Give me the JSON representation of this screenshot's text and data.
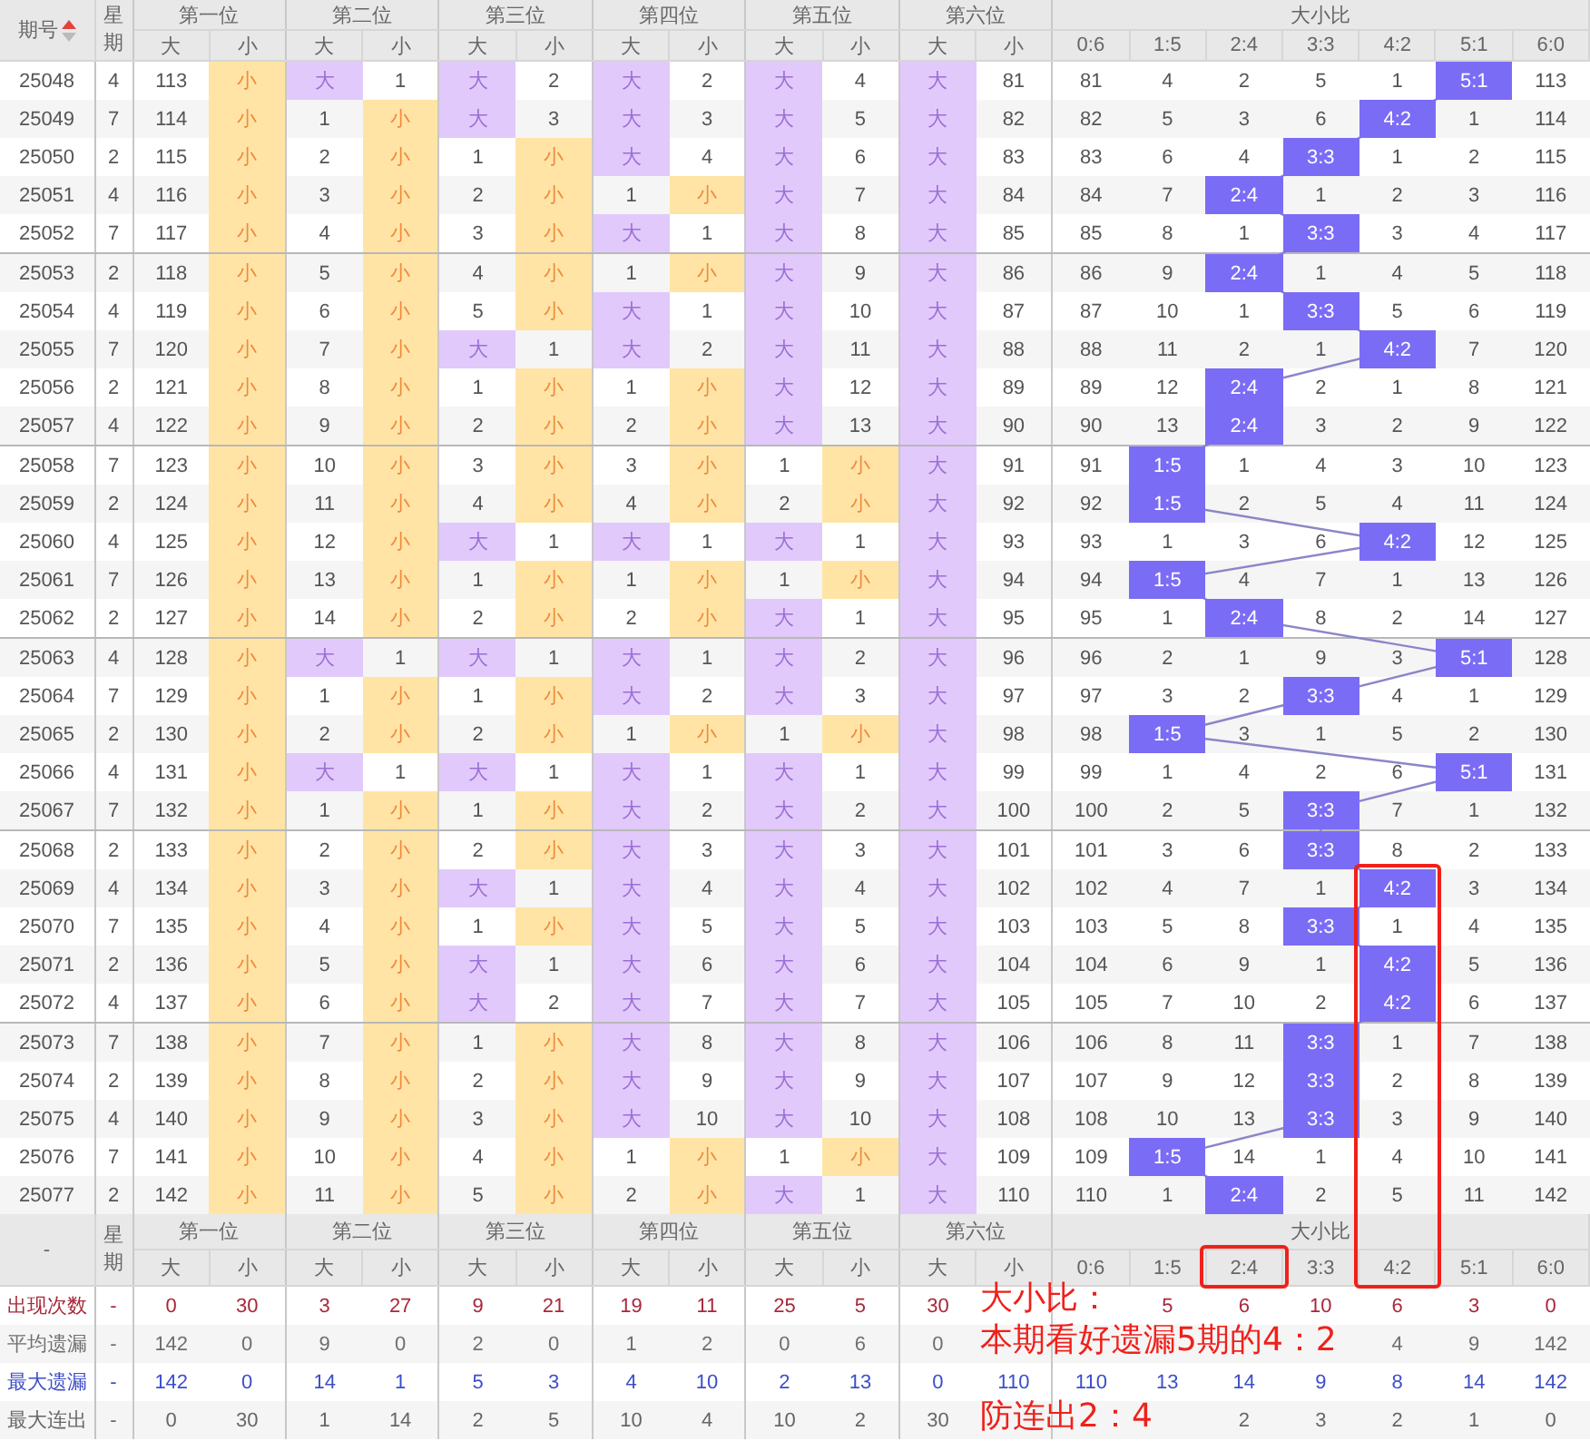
{
  "header": {
    "issue": "期号",
    "weekday": "星期",
    "positions": [
      {
        "name": "第一位",
        "big": "大",
        "small": "小"
      },
      {
        "name": "第二位",
        "big": "大",
        "small": "小"
      },
      {
        "name": "第三位",
        "big": "大",
        "small": "小"
      },
      {
        "name": "第四位",
        "big": "大",
        "small": "小"
      },
      {
        "name": "第五位",
        "big": "大",
        "small": "小"
      },
      {
        "name": "第六位",
        "big": "大",
        "small": "小"
      }
    ],
    "ratio_title": "大小比",
    "ratios": [
      "0:6",
      "1:5",
      "2:4",
      "3:3",
      "4:2",
      "5:1",
      "6:0"
    ]
  },
  "rows": [
    {
      "issue": "25048",
      "weekday": "4",
      "cells": [
        "113",
        "小",
        "大",
        "1",
        "大",
        "2",
        "大",
        "2",
        "大",
        "4",
        "大",
        "81"
      ],
      "big_selected": [
        false,
        true,
        true,
        true,
        true,
        true
      ],
      "ratio": [
        "81",
        "4",
        "2",
        "5",
        "1",
        "5:1",
        "113"
      ],
      "ratio_selected": [
        false,
        false,
        false,
        false,
        false,
        true,
        false
      ]
    },
    {
      "issue": "25049",
      "weekday": "7",
      "cells": [
        "114",
        "小",
        "1",
        "小",
        "大",
        "3",
        "大",
        "3",
        "大",
        "5",
        "大",
        "82"
      ],
      "big_selected": [
        false,
        false,
        true,
        true,
        true,
        true
      ],
      "ratio": [
        "82",
        "5",
        "3",
        "6",
        "4:2",
        "1",
        "114"
      ],
      "ratio_selected": [
        false,
        false,
        false,
        false,
        true,
        false,
        false
      ]
    },
    {
      "issue": "25050",
      "weekday": "2",
      "cells": [
        "115",
        "小",
        "2",
        "小",
        "1",
        "小",
        "大",
        "4",
        "大",
        "6",
        "大",
        "83"
      ],
      "big_selected": [
        false,
        false,
        false,
        true,
        true,
        true
      ],
      "ratio": [
        "83",
        "6",
        "4",
        "3:3",
        "1",
        "2",
        "115"
      ],
      "ratio_selected": [
        false,
        false,
        false,
        true,
        false,
        false,
        false
      ]
    },
    {
      "issue": "25051",
      "weekday": "4",
      "cells": [
        "116",
        "小",
        "3",
        "小",
        "2",
        "小",
        "1",
        "小",
        "大",
        "7",
        "大",
        "84"
      ],
      "big_selected": [
        false,
        false,
        false,
        false,
        true,
        true
      ],
      "ratio": [
        "84",
        "7",
        "2:4",
        "1",
        "2",
        "3",
        "116"
      ],
      "ratio_selected": [
        false,
        false,
        true,
        false,
        false,
        false,
        false
      ]
    },
    {
      "issue": "25052",
      "weekday": "7",
      "cells": [
        "117",
        "小",
        "4",
        "小",
        "3",
        "小",
        "大",
        "1",
        "大",
        "8",
        "大",
        "85"
      ],
      "big_selected": [
        false,
        false,
        false,
        true,
        true,
        true
      ],
      "ratio": [
        "85",
        "8",
        "1",
        "3:3",
        "3",
        "4",
        "117"
      ],
      "ratio_selected": [
        false,
        false,
        false,
        true,
        false,
        false,
        false
      ]
    },
    {
      "issue": "25053",
      "weekday": "2",
      "cells": [
        "118",
        "小",
        "5",
        "小",
        "4",
        "小",
        "1",
        "小",
        "大",
        "9",
        "大",
        "86"
      ],
      "big_selected": [
        false,
        false,
        false,
        false,
        true,
        true
      ],
      "ratio": [
        "86",
        "9",
        "2:4",
        "1",
        "4",
        "5",
        "118"
      ],
      "ratio_selected": [
        false,
        false,
        true,
        false,
        false,
        false,
        false
      ]
    },
    {
      "issue": "25054",
      "weekday": "4",
      "cells": [
        "119",
        "小",
        "6",
        "小",
        "5",
        "小",
        "大",
        "1",
        "大",
        "10",
        "大",
        "87"
      ],
      "big_selected": [
        false,
        false,
        false,
        true,
        true,
        true
      ],
      "ratio": [
        "87",
        "10",
        "1",
        "3:3",
        "5",
        "6",
        "119"
      ],
      "ratio_selected": [
        false,
        false,
        false,
        true,
        false,
        false,
        false
      ]
    },
    {
      "issue": "25055",
      "weekday": "7",
      "cells": [
        "120",
        "小",
        "7",
        "小",
        "大",
        "1",
        "大",
        "2",
        "大",
        "11",
        "大",
        "88"
      ],
      "big_selected": [
        false,
        false,
        true,
        true,
        true,
        true
      ],
      "ratio": [
        "88",
        "11",
        "2",
        "1",
        "4:2",
        "7",
        "120"
      ],
      "ratio_selected": [
        false,
        false,
        false,
        false,
        true,
        false,
        false
      ]
    },
    {
      "issue": "25056",
      "weekday": "2",
      "cells": [
        "121",
        "小",
        "8",
        "小",
        "1",
        "小",
        "1",
        "小",
        "大",
        "12",
        "大",
        "89"
      ],
      "big_selected": [
        false,
        false,
        false,
        false,
        true,
        true
      ],
      "ratio": [
        "89",
        "12",
        "2:4",
        "2",
        "1",
        "8",
        "121"
      ],
      "ratio_selected": [
        false,
        false,
        true,
        false,
        false,
        false,
        false
      ]
    },
    {
      "issue": "25057",
      "weekday": "4",
      "cells": [
        "122",
        "小",
        "9",
        "小",
        "2",
        "小",
        "2",
        "小",
        "大",
        "13",
        "大",
        "90"
      ],
      "big_selected": [
        false,
        false,
        false,
        false,
        true,
        true
      ],
      "ratio": [
        "90",
        "13",
        "2:4",
        "3",
        "2",
        "9",
        "122"
      ],
      "ratio_selected": [
        false,
        false,
        true,
        false,
        false,
        false,
        false
      ]
    },
    {
      "issue": "25058",
      "weekday": "7",
      "cells": [
        "123",
        "小",
        "10",
        "小",
        "3",
        "小",
        "3",
        "小",
        "1",
        "小",
        "大",
        "91"
      ],
      "big_selected": [
        false,
        false,
        false,
        false,
        false,
        true
      ],
      "ratio": [
        "91",
        "1:5",
        "1",
        "4",
        "3",
        "10",
        "123"
      ],
      "ratio_selected": [
        false,
        true,
        false,
        false,
        false,
        false,
        false
      ]
    },
    {
      "issue": "25059",
      "weekday": "2",
      "cells": [
        "124",
        "小",
        "11",
        "小",
        "4",
        "小",
        "4",
        "小",
        "2",
        "小",
        "大",
        "92"
      ],
      "big_selected": [
        false,
        false,
        false,
        false,
        false,
        true
      ],
      "ratio": [
        "92",
        "1:5",
        "2",
        "5",
        "4",
        "11",
        "124"
      ],
      "ratio_selected": [
        false,
        true,
        false,
        false,
        false,
        false,
        false
      ]
    },
    {
      "issue": "25060",
      "weekday": "4",
      "cells": [
        "125",
        "小",
        "12",
        "小",
        "大",
        "1",
        "大",
        "1",
        "大",
        "1",
        "大",
        "93"
      ],
      "big_selected": [
        false,
        false,
        true,
        true,
        true,
        true
      ],
      "ratio": [
        "93",
        "1",
        "3",
        "6",
        "4:2",
        "12",
        "125"
      ],
      "ratio_selected": [
        false,
        false,
        false,
        false,
        true,
        false,
        false
      ]
    },
    {
      "issue": "25061",
      "weekday": "7",
      "cells": [
        "126",
        "小",
        "13",
        "小",
        "1",
        "小",
        "1",
        "小",
        "1",
        "小",
        "大",
        "94"
      ],
      "big_selected": [
        false,
        false,
        false,
        false,
        false,
        true
      ],
      "ratio": [
        "94",
        "1:5",
        "4",
        "7",
        "1",
        "13",
        "126"
      ],
      "ratio_selected": [
        false,
        true,
        false,
        false,
        false,
        false,
        false
      ]
    },
    {
      "issue": "25062",
      "weekday": "2",
      "cells": [
        "127",
        "小",
        "14",
        "小",
        "2",
        "小",
        "2",
        "小",
        "大",
        "1",
        "大",
        "95"
      ],
      "big_selected": [
        false,
        false,
        false,
        false,
        true,
        true
      ],
      "ratio": [
        "95",
        "1",
        "2:4",
        "8",
        "2",
        "14",
        "127"
      ],
      "ratio_selected": [
        false,
        false,
        true,
        false,
        false,
        false,
        false
      ]
    },
    {
      "issue": "25063",
      "weekday": "4",
      "cells": [
        "128",
        "小",
        "大",
        "1",
        "大",
        "1",
        "大",
        "1",
        "大",
        "2",
        "大",
        "96"
      ],
      "big_selected": [
        false,
        true,
        true,
        true,
        true,
        true
      ],
      "ratio": [
        "96",
        "2",
        "1",
        "9",
        "3",
        "5:1",
        "128"
      ],
      "ratio_selected": [
        false,
        false,
        false,
        false,
        false,
        true,
        false
      ]
    },
    {
      "issue": "25064",
      "weekday": "7",
      "cells": [
        "129",
        "小",
        "1",
        "小",
        "1",
        "小",
        "大",
        "2",
        "大",
        "3",
        "大",
        "97"
      ],
      "big_selected": [
        false,
        false,
        false,
        true,
        true,
        true
      ],
      "ratio": [
        "97",
        "3",
        "2",
        "3:3",
        "4",
        "1",
        "129"
      ],
      "ratio_selected": [
        false,
        false,
        false,
        true,
        false,
        false,
        false
      ]
    },
    {
      "issue": "25065",
      "weekday": "2",
      "cells": [
        "130",
        "小",
        "2",
        "小",
        "2",
        "小",
        "1",
        "小",
        "1",
        "小",
        "大",
        "98"
      ],
      "big_selected": [
        false,
        false,
        false,
        false,
        false,
        true
      ],
      "ratio": [
        "98",
        "1:5",
        "3",
        "1",
        "5",
        "2",
        "130"
      ],
      "ratio_selected": [
        false,
        true,
        false,
        false,
        false,
        false,
        false
      ]
    },
    {
      "issue": "25066",
      "weekday": "4",
      "cells": [
        "131",
        "小",
        "大",
        "1",
        "大",
        "1",
        "大",
        "1",
        "大",
        "1",
        "大",
        "99"
      ],
      "big_selected": [
        false,
        true,
        true,
        true,
        true,
        true
      ],
      "ratio": [
        "99",
        "1",
        "4",
        "2",
        "6",
        "5:1",
        "131"
      ],
      "ratio_selected": [
        false,
        false,
        false,
        false,
        false,
        true,
        false
      ]
    },
    {
      "issue": "25067",
      "weekday": "7",
      "cells": [
        "132",
        "小",
        "1",
        "小",
        "1",
        "小",
        "大",
        "2",
        "大",
        "2",
        "大",
        "100"
      ],
      "big_selected": [
        false,
        false,
        false,
        true,
        true,
        true
      ],
      "ratio": [
        "100",
        "2",
        "5",
        "3:3",
        "7",
        "1",
        "132"
      ],
      "ratio_selected": [
        false,
        false,
        false,
        true,
        false,
        false,
        false
      ]
    },
    {
      "issue": "25068",
      "weekday": "2",
      "cells": [
        "133",
        "小",
        "2",
        "小",
        "2",
        "小",
        "大",
        "3",
        "大",
        "3",
        "大",
        "101"
      ],
      "big_selected": [
        false,
        false,
        false,
        true,
        true,
        true
      ],
      "ratio": [
        "101",
        "3",
        "6",
        "3:3",
        "8",
        "2",
        "133"
      ],
      "ratio_selected": [
        false,
        false,
        false,
        true,
        false,
        false,
        false
      ]
    },
    {
      "issue": "25069",
      "weekday": "4",
      "cells": [
        "134",
        "小",
        "3",
        "小",
        "大",
        "1",
        "大",
        "4",
        "大",
        "4",
        "大",
        "102"
      ],
      "big_selected": [
        false,
        false,
        true,
        true,
        true,
        true
      ],
      "ratio": [
        "102",
        "4",
        "7",
        "1",
        "4:2",
        "3",
        "134"
      ],
      "ratio_selected": [
        false,
        false,
        false,
        false,
        true,
        false,
        false
      ]
    },
    {
      "issue": "25070",
      "weekday": "7",
      "cells": [
        "135",
        "小",
        "4",
        "小",
        "1",
        "小",
        "大",
        "5",
        "大",
        "5",
        "大",
        "103"
      ],
      "big_selected": [
        false,
        false,
        false,
        true,
        true,
        true
      ],
      "ratio": [
        "103",
        "5",
        "8",
        "3:3",
        "1",
        "4",
        "135"
      ],
      "ratio_selected": [
        false,
        false,
        false,
        true,
        false,
        false,
        false
      ]
    },
    {
      "issue": "25071",
      "weekday": "2",
      "cells": [
        "136",
        "小",
        "5",
        "小",
        "大",
        "1",
        "大",
        "6",
        "大",
        "6",
        "大",
        "104"
      ],
      "big_selected": [
        false,
        false,
        true,
        true,
        true,
        true
      ],
      "ratio": [
        "104",
        "6",
        "9",
        "1",
        "4:2",
        "5",
        "136"
      ],
      "ratio_selected": [
        false,
        false,
        false,
        false,
        true,
        false,
        false
      ]
    },
    {
      "issue": "25072",
      "weekday": "4",
      "cells": [
        "137",
        "小",
        "6",
        "小",
        "大",
        "2",
        "大",
        "7",
        "大",
        "7",
        "大",
        "105"
      ],
      "big_selected": [
        false,
        false,
        true,
        true,
        true,
        true
      ],
      "ratio": [
        "105",
        "7",
        "10",
        "2",
        "4:2",
        "6",
        "137"
      ],
      "ratio_selected": [
        false,
        false,
        false,
        false,
        true,
        false,
        false
      ]
    },
    {
      "issue": "25073",
      "weekday": "7",
      "cells": [
        "138",
        "小",
        "7",
        "小",
        "1",
        "小",
        "大",
        "8",
        "大",
        "8",
        "大",
        "106"
      ],
      "big_selected": [
        false,
        false,
        false,
        true,
        true,
        true
      ],
      "ratio": [
        "106",
        "8",
        "11",
        "3:3",
        "1",
        "7",
        "138"
      ],
      "ratio_selected": [
        false,
        false,
        false,
        true,
        false,
        false,
        false
      ]
    },
    {
      "issue": "25074",
      "weekday": "2",
      "cells": [
        "139",
        "小",
        "8",
        "小",
        "2",
        "小",
        "大",
        "9",
        "大",
        "9",
        "大",
        "107"
      ],
      "big_selected": [
        false,
        false,
        false,
        true,
        true,
        true
      ],
      "ratio": [
        "107",
        "9",
        "12",
        "3:3",
        "2",
        "8",
        "139"
      ],
      "ratio_selected": [
        false,
        false,
        false,
        true,
        false,
        false,
        false
      ]
    },
    {
      "issue": "25075",
      "weekday": "4",
      "cells": [
        "140",
        "小",
        "9",
        "小",
        "3",
        "小",
        "大",
        "10",
        "大",
        "10",
        "大",
        "108"
      ],
      "big_selected": [
        false,
        false,
        false,
        true,
        true,
        true
      ],
      "ratio": [
        "108",
        "10",
        "13",
        "3:3",
        "3",
        "9",
        "140"
      ],
      "ratio_selected": [
        false,
        false,
        false,
        true,
        false,
        false,
        false
      ]
    },
    {
      "issue": "25076",
      "weekday": "7",
      "cells": [
        "141",
        "小",
        "10",
        "小",
        "4",
        "小",
        "1",
        "小",
        "1",
        "小",
        "大",
        "109"
      ],
      "big_selected": [
        false,
        false,
        false,
        false,
        false,
        true
      ],
      "ratio": [
        "109",
        "1:5",
        "14",
        "1",
        "4",
        "10",
        "141"
      ],
      "ratio_selected": [
        false,
        true,
        false,
        false,
        false,
        false,
        false
      ]
    },
    {
      "issue": "25077",
      "weekday": "2",
      "cells": [
        "142",
        "小",
        "11",
        "小",
        "5",
        "小",
        "2",
        "小",
        "大",
        "1",
        "大",
        "110"
      ],
      "big_selected": [
        false,
        false,
        false,
        false,
        true,
        true
      ],
      "ratio": [
        "110",
        "1",
        "2:4",
        "2",
        "5",
        "11",
        "142"
      ],
      "ratio_selected": [
        false,
        false,
        true,
        false,
        false,
        false,
        false
      ]
    }
  ],
  "footer_header": {
    "issue": "-",
    "weekday": "星期",
    "positions": [
      {
        "name": "第一位",
        "big": "大",
        "small": "小"
      },
      {
        "name": "第二位",
        "big": "大",
        "small": "小"
      },
      {
        "name": "第三位",
        "big": "大",
        "small": "小"
      },
      {
        "name": "第四位",
        "big": "大",
        "small": "小"
      },
      {
        "name": "第五位",
        "big": "大",
        "small": "小"
      },
      {
        "name": "第六位",
        "big": "大",
        "small": "小"
      }
    ],
    "ratio_title": "大小比",
    "ratios": [
      "0:6",
      "1:5",
      "2:4",
      "3:3",
      "4:2",
      "5:1",
      "6:0"
    ]
  },
  "stats": [
    {
      "label": "出现次数",
      "color": "#a8283a",
      "weekday": "-",
      "values": [
        "0",
        "30",
        "3",
        "27",
        "9",
        "21",
        "19",
        "11",
        "25",
        "5",
        "30"
      ],
      "ratio": [
        "5",
        "6",
        "10",
        "6",
        "3",
        "0"
      ]
    },
    {
      "label": "平均遗漏",
      "color": "#6f6f6f",
      "weekday": "-",
      "values": [
        "142",
        "0",
        "9",
        "0",
        "2",
        "0",
        "1",
        "2",
        "0",
        "6",
        "0"
      ],
      "ratio": [
        "4",
        "9",
        "142"
      ]
    },
    {
      "label": "最大遗漏",
      "color": "#3c4fc8",
      "weekday": "-",
      "values": [
        "142",
        "0",
        "14",
        "1",
        "5",
        "3",
        "4",
        "10",
        "2",
        "13",
        "0",
        "110"
      ],
      "ratio": [
        "110",
        "13",
        "14",
        "9",
        "8",
        "14",
        "142"
      ]
    },
    {
      "label": "最大连出",
      "color": "#666666",
      "weekday": "-",
      "values": [
        "0",
        "30",
        "1",
        "14",
        "2",
        "5",
        "10",
        "4",
        "10",
        "2",
        "30"
      ],
      "ratio": [
        "2",
        "3",
        "2",
        "1",
        "0"
      ]
    }
  ],
  "annotation": {
    "lines": [
      "大小比：",
      "本期看好遗漏5期的4：2",
      "防连出2：4"
    ]
  }
}
